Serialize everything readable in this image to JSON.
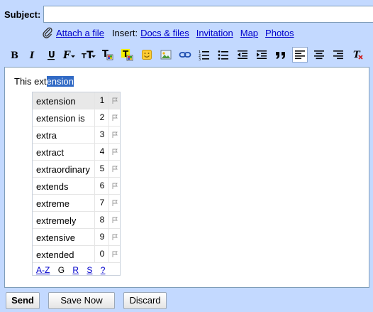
{
  "subject": {
    "label": "Subject:",
    "value": ""
  },
  "attach": {
    "attach_label": "Attach a file",
    "insert_label": "Insert:",
    "insert_links": [
      "Docs & files",
      "Invitation",
      "Map",
      "Photos"
    ]
  },
  "toolbar": {
    "items": [
      "bold-icon",
      "italic-icon",
      "underline-icon",
      "font-icon",
      "font-size-icon",
      "text-color-icon",
      "highlight-color-icon",
      "emoticon-icon",
      "insert-image-icon",
      "link-icon",
      "numbered-list-icon",
      "bulleted-list-icon",
      "indent-less-icon",
      "indent-more-icon",
      "quote-icon",
      "align-left-icon",
      "align-center-icon",
      "align-right-icon",
      "remove-formatting-icon"
    ],
    "active": "align-left-icon"
  },
  "editor": {
    "text_before": "This ext",
    "text_selected": "ension"
  },
  "suggestions": {
    "items": [
      {
        "word": "extension",
        "num": "1"
      },
      {
        "word": "extension is",
        "num": "2"
      },
      {
        "word": "extra",
        "num": "3"
      },
      {
        "word": "extract",
        "num": "4"
      },
      {
        "word": "extraordinary",
        "num": "5"
      },
      {
        "word": "extends",
        "num": "6"
      },
      {
        "word": "extreme",
        "num": "7"
      },
      {
        "word": "extremely",
        "num": "8"
      },
      {
        "word": "extensive",
        "num": "9"
      },
      {
        "word": "extended",
        "num": "0"
      }
    ],
    "footer_links": [
      "A-Z",
      "G",
      "R",
      "S",
      "?"
    ]
  },
  "buttons": {
    "send": "Send",
    "save_now": "Save Now",
    "discard": "Discard"
  }
}
